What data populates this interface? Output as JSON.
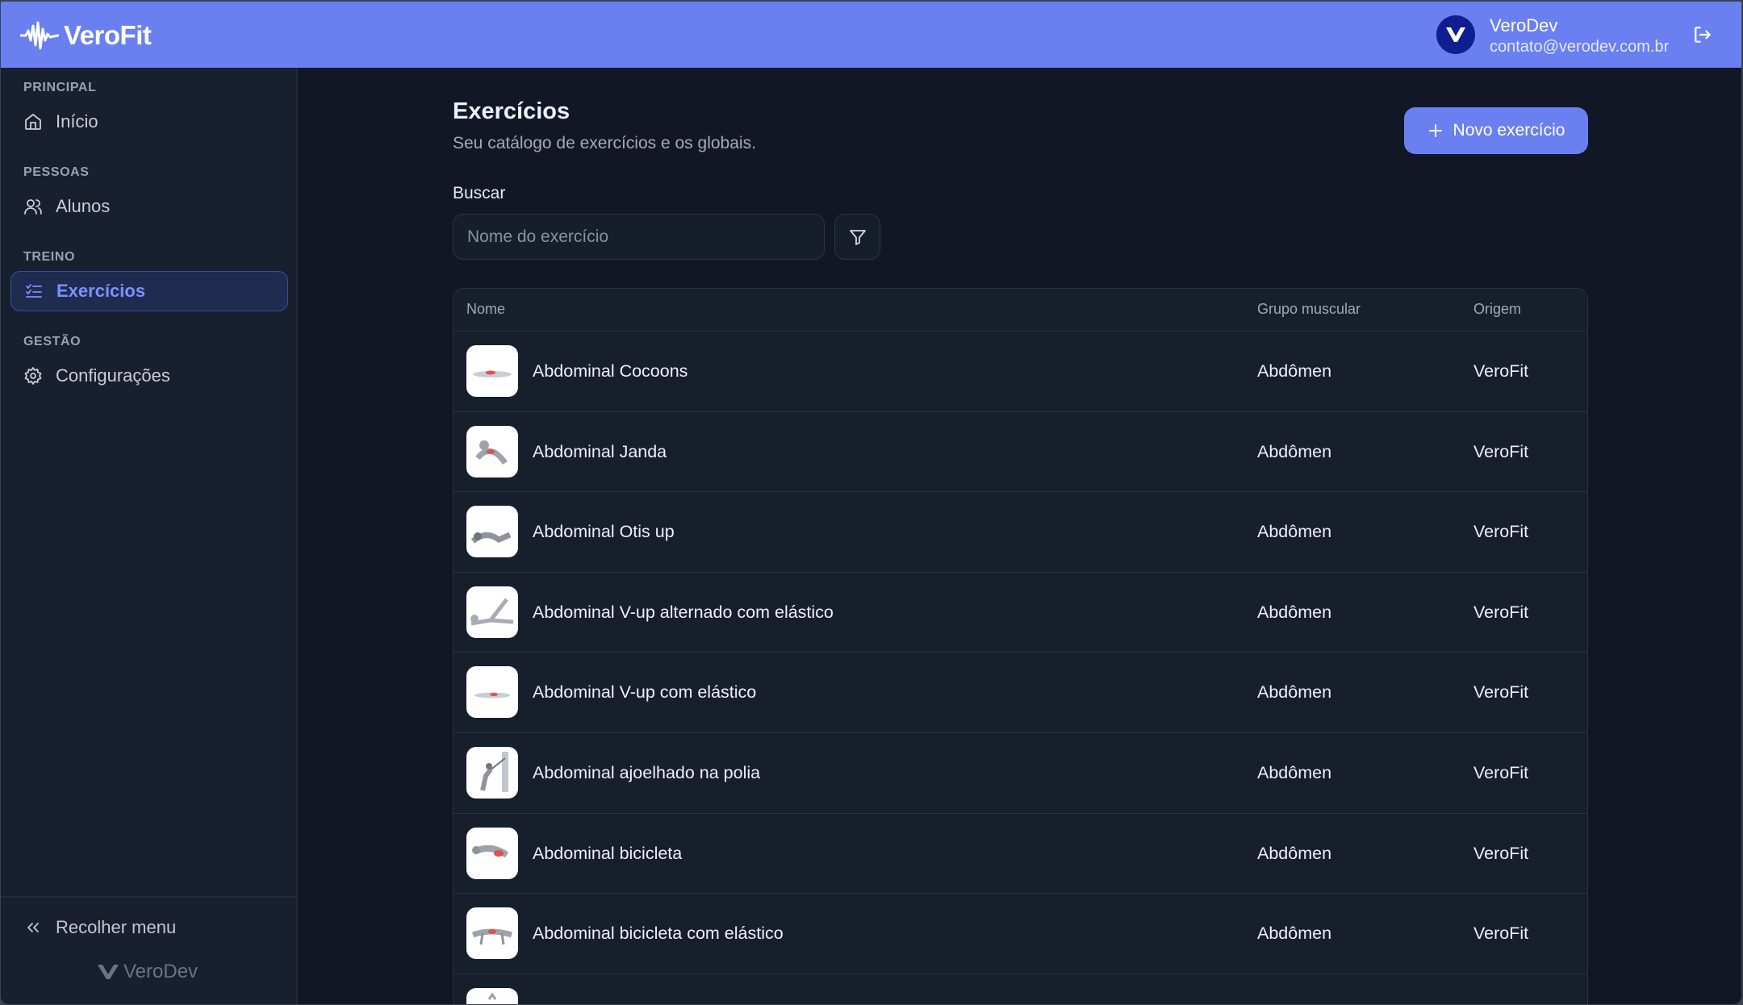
{
  "header": {
    "brand": "VeroFit",
    "user_name": "VeroDev",
    "user_email": "contato@verodev.com.br",
    "colors": {
      "primary": "#6a80f1",
      "avatar": "#0f1f8f"
    }
  },
  "sidebar": {
    "sections": [
      {
        "label": "PRINCIPAL",
        "items": [
          {
            "label": "Início",
            "icon": "home-icon",
            "active": false
          }
        ]
      },
      {
        "label": "PESSOAS",
        "items": [
          {
            "label": "Alunos",
            "icon": "users-icon",
            "active": false
          }
        ]
      },
      {
        "label": "TREINO",
        "items": [
          {
            "label": "Exercícios",
            "icon": "list-check-icon",
            "active": true
          }
        ]
      },
      {
        "label": "GESTÃO",
        "items": [
          {
            "label": "Configurações",
            "icon": "gear-icon",
            "active": false
          }
        ]
      }
    ],
    "collapse_label": "Recolher menu",
    "footer_brand": "VeroDev"
  },
  "page": {
    "title": "Exercícios",
    "subtitle": "Seu catálogo de exercícios e os globais.",
    "new_button": "Novo exercício",
    "search_label": "Buscar",
    "search_placeholder": "Nome do exercício"
  },
  "table": {
    "columns": [
      "Nome",
      "Grupo muscular",
      "Origem"
    ],
    "rows": [
      {
        "name": "Abdominal Cocoons",
        "group": "Abdômen",
        "origin": "VeroFit"
      },
      {
        "name": "Abdominal Janda",
        "group": "Abdômen",
        "origin": "VeroFit"
      },
      {
        "name": "Abdominal Otis up",
        "group": "Abdômen",
        "origin": "VeroFit"
      },
      {
        "name": "Abdominal V-up alternado com elástico",
        "group": "Abdômen",
        "origin": "VeroFit"
      },
      {
        "name": "Abdominal V-up com elástico",
        "group": "Abdômen",
        "origin": "VeroFit"
      },
      {
        "name": "Abdominal ajoelhado na polia",
        "group": "Abdômen",
        "origin": "VeroFit"
      },
      {
        "name": "Abdominal bicicleta",
        "group": "Abdômen",
        "origin": "VeroFit"
      },
      {
        "name": "Abdominal bicicleta com elástico",
        "group": "Abdômen",
        "origin": "VeroFit"
      },
      {
        "name": "",
        "group": "",
        "origin": ""
      }
    ]
  }
}
